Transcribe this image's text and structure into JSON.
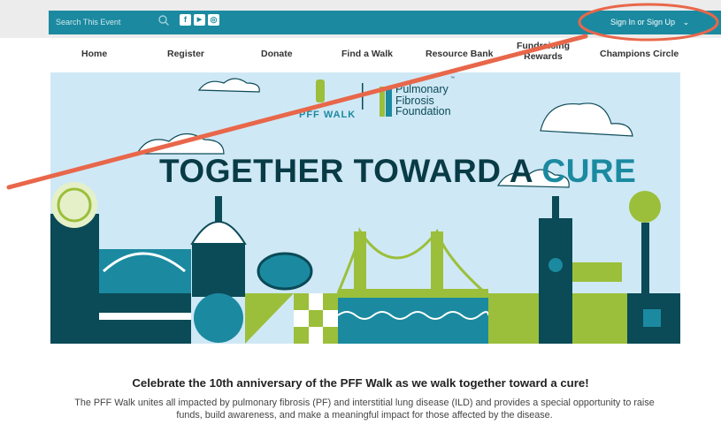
{
  "search": {
    "placeholder": "Search This Event"
  },
  "social": {
    "facebook": "f",
    "youtube": "▶",
    "instagram": "◎"
  },
  "account": {
    "label": "Sign In or Sign Up",
    "chevron": "⌄"
  },
  "nav": {
    "items": [
      {
        "label": "Home"
      },
      {
        "label": "Register"
      },
      {
        "label": "Donate"
      },
      {
        "label": "Find a Walk"
      },
      {
        "label": "Resource Bank"
      },
      {
        "label": "Fundraising Rewards"
      },
      {
        "label": "Champions Circle"
      }
    ]
  },
  "hero": {
    "logo_walk": "PFF WALK",
    "logo_org_line1": "Pulmonary",
    "logo_org_line2": "Fibrosis",
    "logo_org_line3": "Foundation",
    "logo_tm": "™",
    "headline_main": "TOGETHER TOWARD A",
    "headline_accent": "CURE"
  },
  "content": {
    "celebrate": "Celebrate the 10th anniversary of the PFF Walk as we walk together toward a cure!",
    "intro": "The PFF Walk unites all impacted by pulmonary fibrosis (PF) and interstitial lung disease (ILD) and provides a special opportunity to raise funds, build awareness, and make a meaningful impact for those affected by the disease."
  },
  "colors": {
    "teal": "#1b8aa0",
    "dark": "#083b45",
    "green": "#9bbf3a",
    "sky": "#cfe8f6",
    "annotation": "#e8674a"
  }
}
